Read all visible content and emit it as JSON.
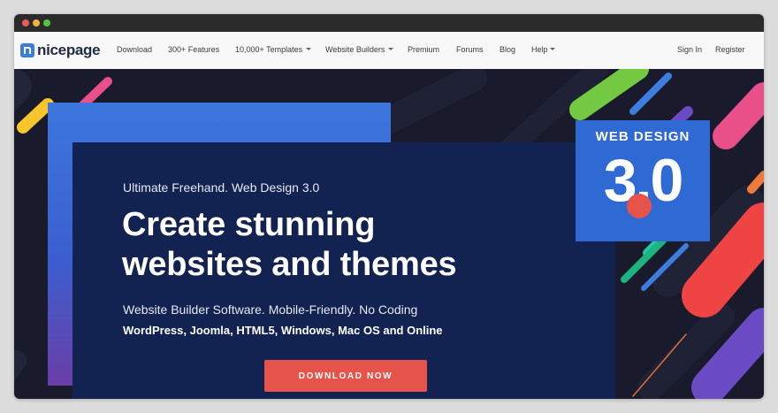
{
  "colors": {
    "accent": "#3b7ddd",
    "cta": "#e5534b",
    "hero_bg": "#191b2c",
    "card_bg": "#122251",
    "badge_bg": "#2f6ad4"
  },
  "logo": {
    "text": "nicepage",
    "icon": "nicepage-logo-icon"
  },
  "nav": {
    "items": [
      {
        "label": "Download",
        "has_dropdown": false
      },
      {
        "label": "300+ Features",
        "has_dropdown": false
      },
      {
        "label": "10,000+ Templates",
        "has_dropdown": true
      },
      {
        "label": "Website Builders",
        "has_dropdown": true
      },
      {
        "label": "Premium",
        "has_dropdown": false
      },
      {
        "label": "Forums",
        "has_dropdown": false
      },
      {
        "label": "Blog",
        "has_dropdown": false
      },
      {
        "label": "Help",
        "has_dropdown": true
      }
    ],
    "sign_in": "Sign In",
    "register": "Register"
  },
  "hero": {
    "tagline": "Ultimate Freehand. Web Design 3.0",
    "headline_line1": "Create stunning",
    "headline_line2": "websites and themes",
    "subtitle": "Website Builder Software. Mobile-Friendly. No Coding",
    "platforms": "WordPress, Joomla, HTML5, Windows, Mac OS and Online",
    "cta_label": "DOWNLOAD NOW"
  },
  "badge": {
    "title": "WEB DESIGN",
    "number": "3.0"
  }
}
